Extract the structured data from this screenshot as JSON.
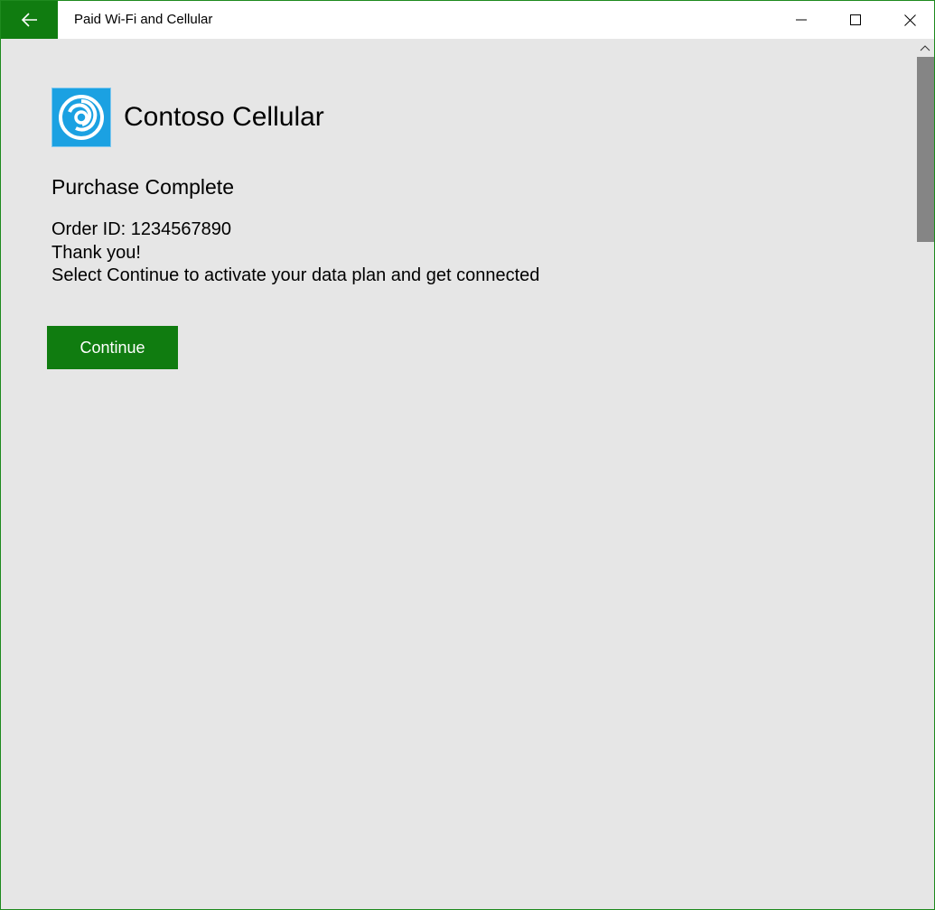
{
  "window": {
    "title": "Paid Wi-Fi and Cellular"
  },
  "brand": {
    "name": "Contoso Cellular",
    "logo_icon": "contoso-swirl-icon",
    "logo_color": "#1ba1e2"
  },
  "page": {
    "heading": "Purchase Complete",
    "order_line": "Order ID: 1234567890",
    "thanks": "Thank you!",
    "instruction": "Select Continue to activate your data plan and get connected"
  },
  "actions": {
    "continue_label": "Continue"
  },
  "theme": {
    "accent": "#107c10",
    "background": "#e6e6e6"
  }
}
